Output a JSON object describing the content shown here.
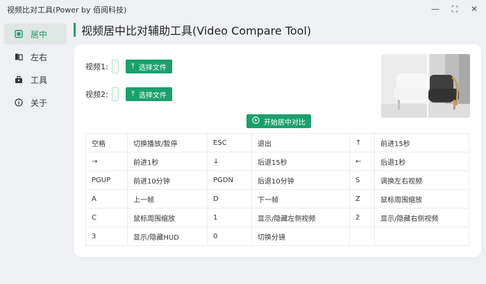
{
  "app": {
    "title": "视频比对工具(Power by 佰阅科技)",
    "accent_color": "#1aa06d"
  },
  "window_controls": {
    "minimize": "—",
    "maximize": "⛶",
    "close": "✕"
  },
  "sidebar": {
    "items": [
      {
        "label": "居中",
        "icon": "center-icon",
        "active": true
      },
      {
        "label": "左右",
        "icon": "split-icon",
        "active": false
      },
      {
        "label": "工具",
        "icon": "toolbox-icon",
        "active": false
      },
      {
        "label": "关于",
        "icon": "info-icon",
        "active": false
      }
    ]
  },
  "header": {
    "title": "视频居中比对辅助工具(Video Compare Tool)"
  },
  "files": {
    "video1_label": "视频1:",
    "video2_label": "视频2:",
    "select_button": "选择文件"
  },
  "actions": {
    "start_button": "开始居中对比"
  },
  "shortcuts": {
    "rows": [
      [
        "空格",
        "切换播放/暂停",
        "ESC",
        "退出",
        "↑",
        "前进15秒"
      ],
      [
        "→",
        "前进1秒",
        "↓",
        "后退15秒",
        "←",
        "后退1秒"
      ],
      [
        "PGUP",
        "前进10分钟",
        "PGDN",
        "后退10分钟",
        "S",
        "调换左右视频"
      ],
      [
        "A",
        "上一帧",
        "D",
        "下一帧",
        "Z",
        "鼠标周围缩放"
      ],
      [
        "C",
        "鼠标周围缩放",
        "1",
        "显示/隐藏左侧视频",
        "2",
        "显示/隐藏右侧视频"
      ],
      [
        "3",
        "显示/隐藏HUD",
        "0",
        "切换分镜",
        "",
        ""
      ]
    ]
  }
}
